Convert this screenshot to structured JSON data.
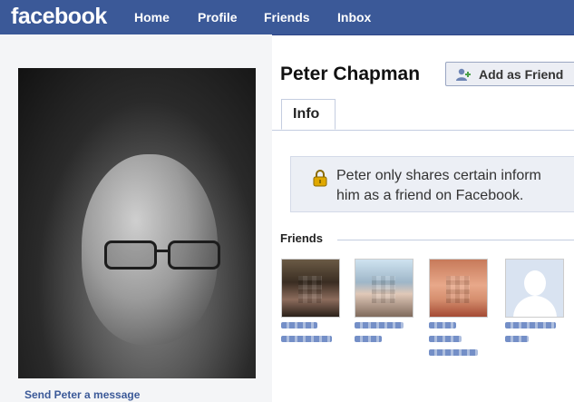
{
  "header": {
    "logo": "facebook",
    "nav": [
      "Home",
      "Profile",
      "Friends",
      "Inbox"
    ]
  },
  "profile": {
    "name": "Peter Chapman",
    "add_friend_label": "Add as Friend",
    "send_message_label": "Send Peter a message"
  },
  "tabs": [
    {
      "label": "Info",
      "active": true
    }
  ],
  "notice": {
    "line1": "Peter only shares certain inform",
    "line2": "him as a friend on Facebook."
  },
  "friends": {
    "heading": "Friends",
    "items": [
      {
        "thumbnail": "blurred-photo"
      },
      {
        "thumbnail": "blurred-photo"
      },
      {
        "thumbnail": "blurred-photo"
      },
      {
        "thumbnail": "default-silhouette"
      }
    ]
  },
  "colors": {
    "brand_blue": "#3b5998",
    "link_blue": "#3b5998",
    "notice_bg": "#eceff5"
  }
}
